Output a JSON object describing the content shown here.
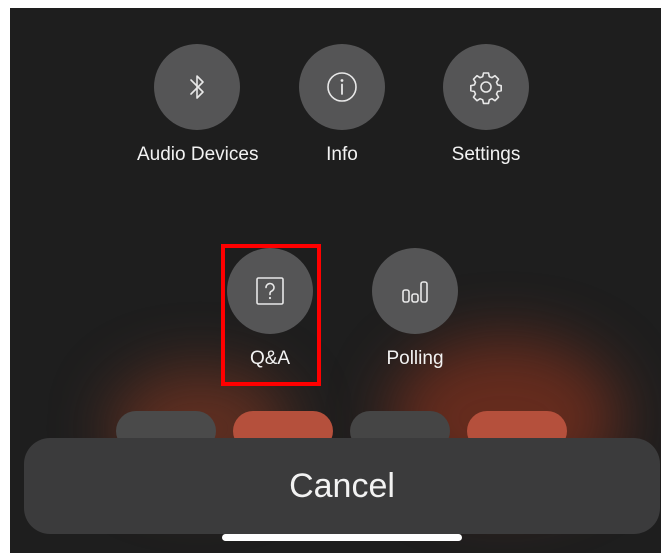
{
  "actions_row1": [
    {
      "label": "Audio Devices",
      "icon": "bluetooth-icon"
    },
    {
      "label": "Info",
      "icon": "info-icon"
    },
    {
      "label": "Settings",
      "icon": "gear-icon"
    }
  ],
  "actions_row2": [
    {
      "label": "Q&A",
      "icon": "question-box-icon",
      "highlighted": true
    },
    {
      "label": "Polling",
      "icon": "poll-bars-icon"
    }
  ],
  "cancel_label": "Cancel",
  "colors": {
    "background": "#1e1e1e",
    "action_circle": "#555556",
    "cancel_bar": "#3b3b3c",
    "highlight": "#ff0000",
    "text": "#f2f2f2"
  }
}
